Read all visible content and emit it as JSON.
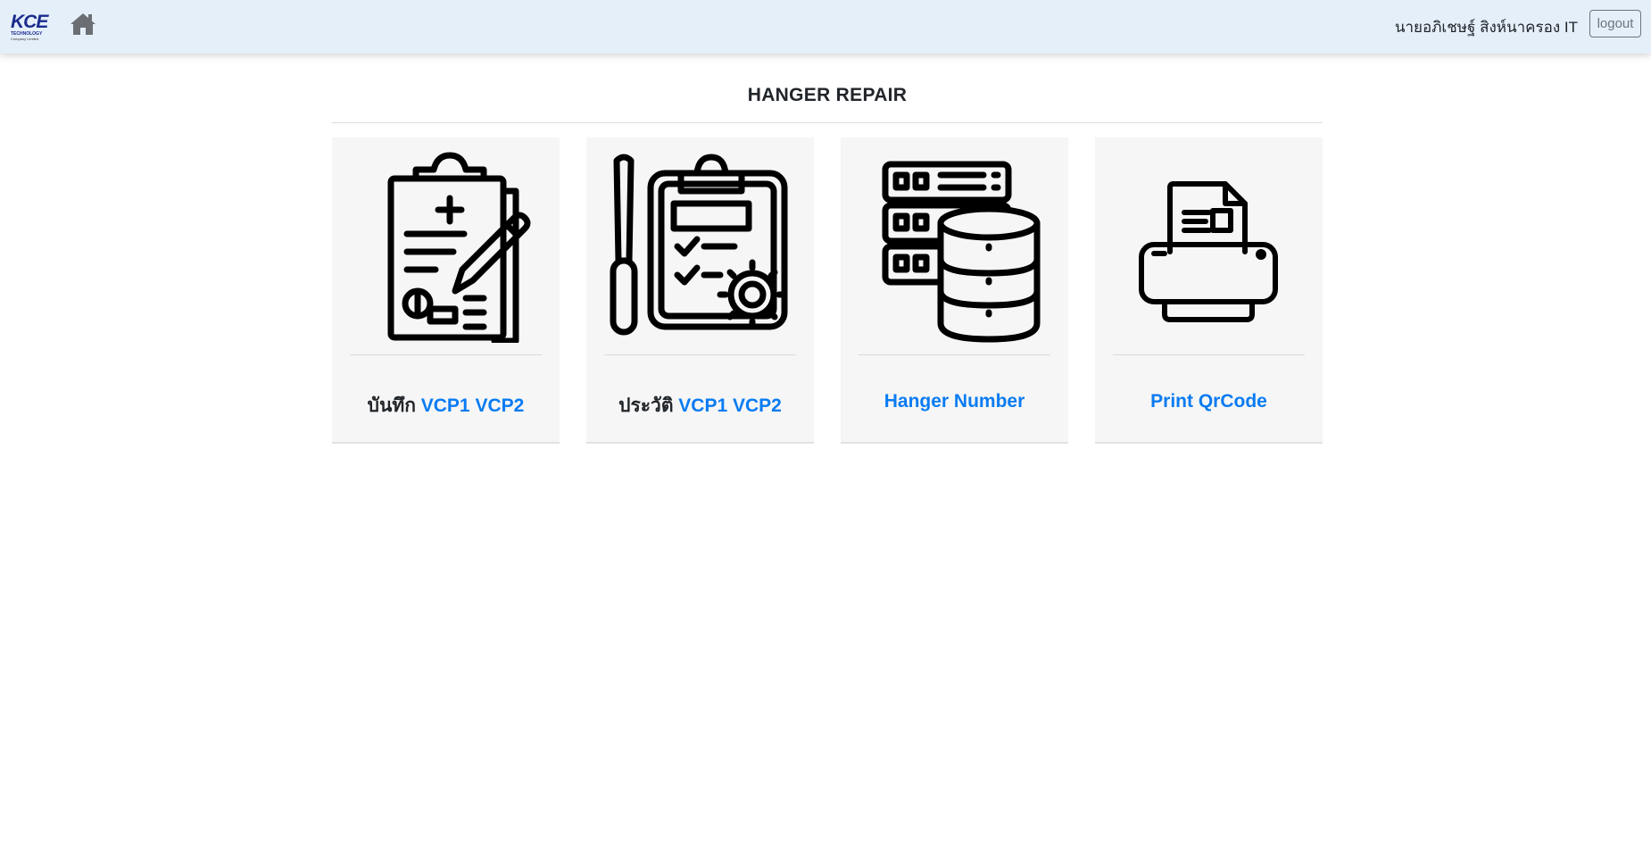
{
  "header": {
    "logo_text": "KCE",
    "logo_sub1": "TECHNOLOGY",
    "logo_sub2": "Company Limited",
    "user_name": "นายอภิเชษฐ์ สิงห์นาครอง IT",
    "logout_label": "logout",
    "home_icon": "home-icon"
  },
  "page": {
    "title": "HANGER REPAIR"
  },
  "cards": [
    {
      "prefix": "บันทึก ",
      "label": "VCP1 VCP2",
      "icon": "clipboard-edit-icon"
    },
    {
      "prefix": "ประวัติ ",
      "label": "VCP1 VCP2",
      "icon": "clipboard-tools-icon"
    },
    {
      "prefix": "",
      "label": "Hanger Number",
      "icon": "server-database-icon"
    },
    {
      "prefix": "",
      "label": "Print QrCode",
      "icon": "printer-icon"
    }
  ],
  "colors": {
    "navbar_bg": "#e4effa",
    "link_blue": "#0a7bf2",
    "card_bg": "#f6f6f6"
  }
}
